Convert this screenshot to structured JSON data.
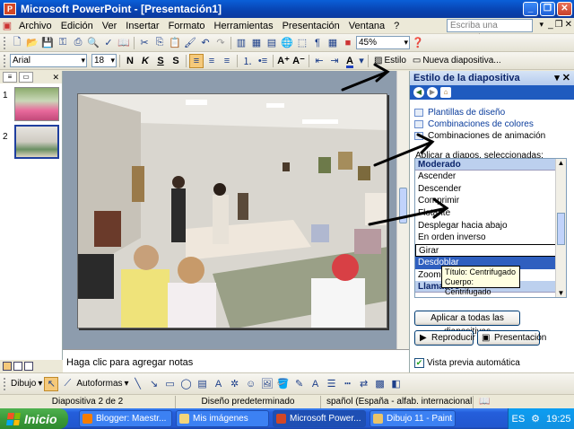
{
  "window": {
    "title": "Microsoft PowerPoint - [Presentación1]"
  },
  "menu": {
    "items": [
      "Archivo",
      "Edición",
      "Ver",
      "Insertar",
      "Formato",
      "Herramientas",
      "Presentación",
      "Ventana",
      "?"
    ],
    "ask_placeholder": "Escriba una pregunta"
  },
  "toolbar_standard": {
    "zoom": "45%"
  },
  "toolbar_format": {
    "font": "Arial",
    "size": "18",
    "bold": "N",
    "italic": "K",
    "underline": "S",
    "shadow": "S",
    "design_label": "Estilo",
    "new_slide_label": "Nueva diapositiva..."
  },
  "slides": {
    "numbers": [
      "1",
      "2"
    ]
  },
  "notes": {
    "placeholder": "Haga clic para agregar notas"
  },
  "taskpane": {
    "title": "Estilo de la diapositiva",
    "links": [
      "Plantillas de diseño",
      "Combinaciones de colores",
      "Combinaciones de animación"
    ],
    "apply_label": "Aplicar a diapos. seleccionadas:",
    "list_header_1": "Moderado",
    "list_items": [
      "Ascender",
      "Descender",
      "Comprimir",
      "Flotante",
      "Desplegar hacia abajo",
      "En orden inverso",
      "Girar",
      "Desdoblar",
      "Zoom"
    ],
    "list_selected": "Desdoblar",
    "list_header_2": "Llamativo",
    "tooltip_line1": "Título: Centrifugado",
    "tooltip_line2": "Cuerpo: Centrifugado",
    "apply_all_button": "Aplicar a todas las diapositivas",
    "play_button": "Reproducir",
    "slideshow_button": "Presentación",
    "autopreview_label": "Vista previa automática",
    "autopreview_checked": true
  },
  "drawing": {
    "draw_label": "Dibujo",
    "autoshapes_label": "Autoformas"
  },
  "status": {
    "slide": "Diapositiva 2 de 2",
    "design": "Diseño predeterminado",
    "language": "spañol (España - alfab. internacional"
  },
  "taskbar": {
    "start_label": "Inicio",
    "buttons": [
      "Blogger: Maestr...",
      "Mis imágenes",
      "Microsoft Power...",
      "Dibujo 11 - Paint"
    ],
    "lang": "ES",
    "clock": "19:25"
  }
}
